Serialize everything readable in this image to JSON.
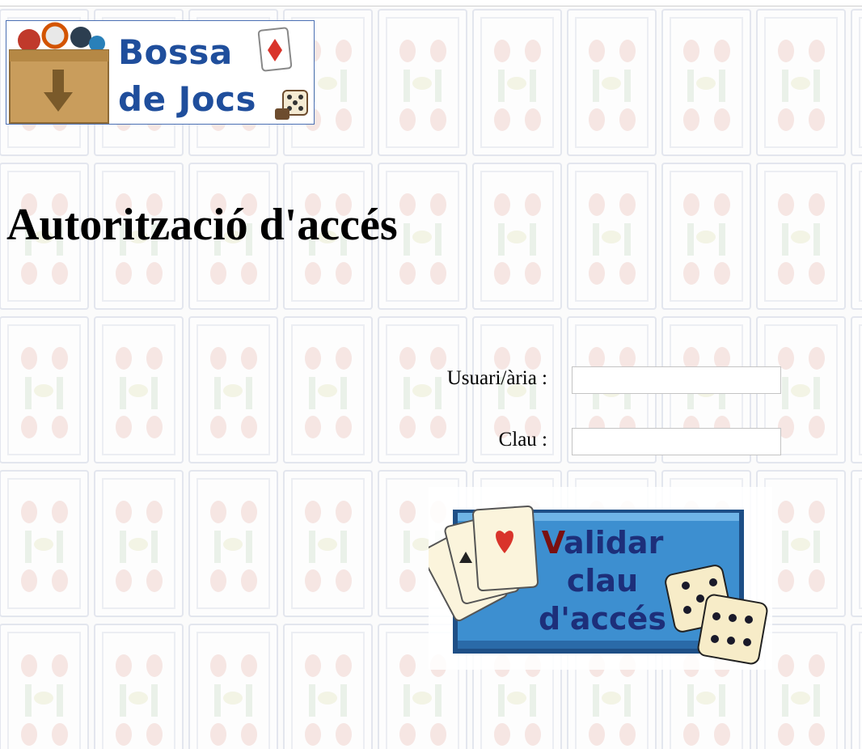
{
  "logo": {
    "line1": "Bossa",
    "line2": "de Jocs"
  },
  "page": {
    "title": "Autorització d'accés"
  },
  "form": {
    "user_label": "Usuari/ària :",
    "user_value": "",
    "password_label": "Clau :",
    "password_value": "",
    "submit": {
      "first_letter": "V",
      "line1_rest": "alidar",
      "line2": "clau",
      "line3": "d'accés"
    }
  },
  "colors": {
    "logo_text": "#1f4e9c",
    "logo_border": "#4a6fb3",
    "button_blue": "#3d8fd0",
    "button_text": "#1d2f7a"
  },
  "icons": {
    "logo": "box-with-arrow-icon",
    "cards": "playing-cards-icon",
    "dice": "dice-icon"
  }
}
